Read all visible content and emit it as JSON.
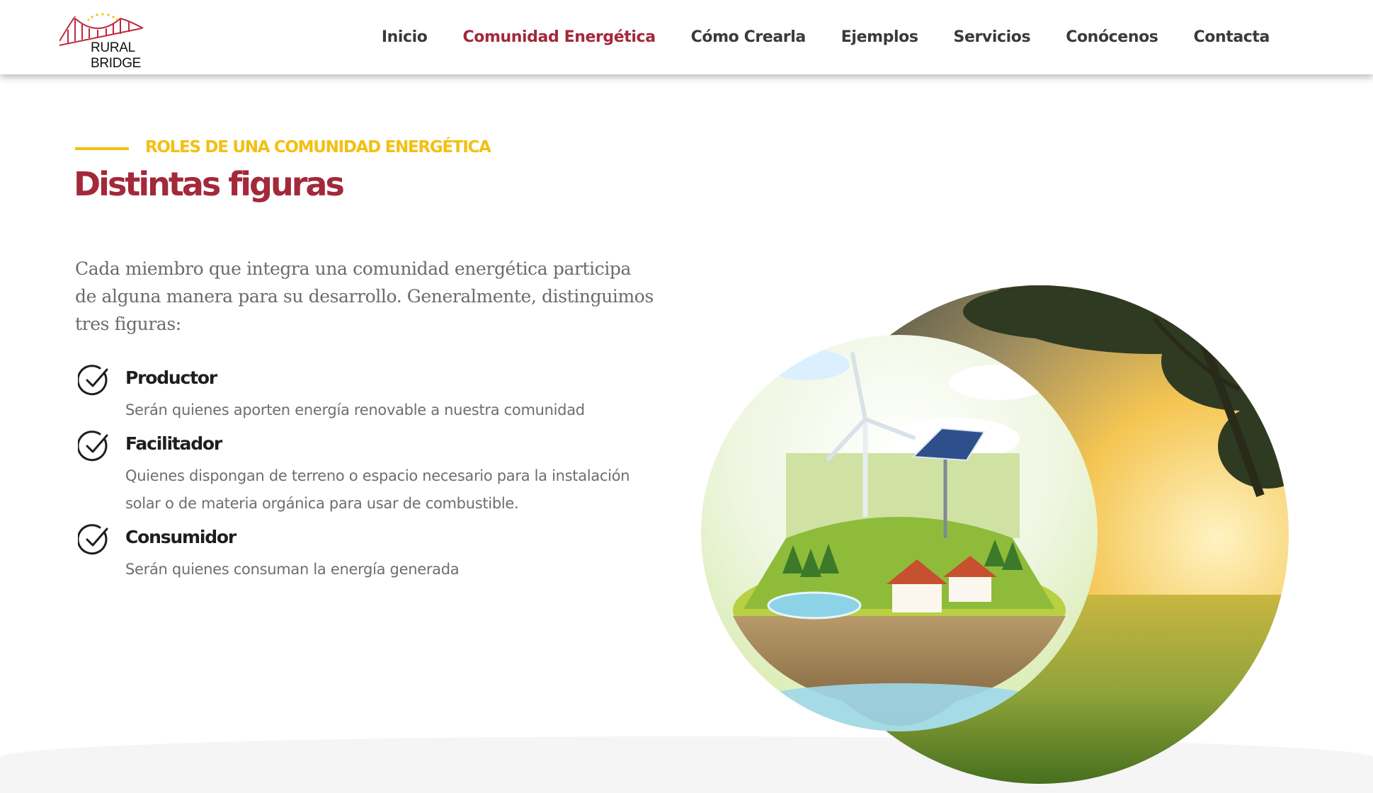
{
  "brand": {
    "logo_text": "RURAL BRIDGE"
  },
  "nav": {
    "items": [
      {
        "label": "Inicio"
      },
      {
        "label": "Comunidad Energética"
      },
      {
        "label": "Cómo Crearla"
      },
      {
        "label": "Ejemplos"
      },
      {
        "label": "Servicios"
      },
      {
        "label": "Conócenos"
      },
      {
        "label": "Contacta"
      }
    ],
    "active_index": 1
  },
  "section": {
    "eyebrow": "ROLES DE UNA COMUNIDAD ENERGÉTICA",
    "title": "Distintas figuras",
    "intro": "Cada miembro que integra una comunidad energética participa de alguna manera para su desarrollo. Generalmente, distinguimos tres figuras:",
    "roles": [
      {
        "name": "Productor",
        "description": "Serán quienes aporten energía renovable a nuestra comunidad"
      },
      {
        "name": "Facilitador",
        "description": "Quienes dispongan de terreno o espacio necesario para la instalación solar o de materia orgánica para usar de combustible."
      },
      {
        "name": "Consumidor",
        "description": "Serán quienes consuman la energía generada"
      }
    ]
  },
  "colors": {
    "accent": "#a3283a",
    "eyebrow": "#f2c012",
    "text_muted": "#6b6b6b"
  },
  "icons": {
    "role_check": "check-circle-icon",
    "logo": "bridge-icon"
  }
}
